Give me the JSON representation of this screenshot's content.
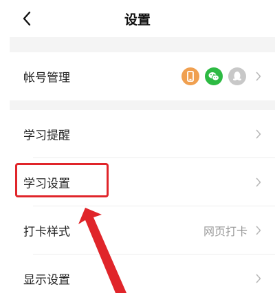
{
  "header": {
    "title": "设置"
  },
  "account": {
    "label": "帐号管理",
    "badges": [
      {
        "icon": "phone-icon",
        "color": "#F0A050"
      },
      {
        "icon": "wechat-icon",
        "color": "#2DBA43"
      },
      {
        "icon": "qq-icon",
        "color": "#C8C8C8"
      }
    ]
  },
  "items": [
    {
      "label": "学习提醒",
      "value": ""
    },
    {
      "label": "学习设置",
      "value": ""
    },
    {
      "label": "打卡样式",
      "value": "网页打卡"
    },
    {
      "label": "显示设置",
      "value": ""
    }
  ],
  "annotation_color": "#E0252A"
}
